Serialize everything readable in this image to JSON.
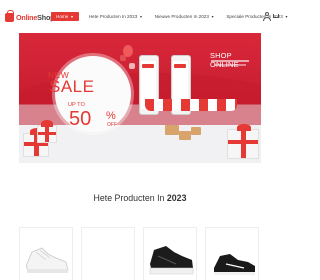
{
  "header": {
    "logo_brand": "Online",
    "logo_brand_suffix": "Shop",
    "nav": [
      {
        "label": "Home",
        "active": true
      },
      {
        "label": "Hete Producten In 2023"
      },
      {
        "label": "Nieuwe Producten In 2023"
      },
      {
        "label": "Speciale Producten In 2023"
      }
    ]
  },
  "banner": {
    "new": "NEW",
    "sale": "SALE",
    "up_to": "UP TO",
    "percent": "50",
    "percent_sign": "%",
    "off": "OFF",
    "shop_online": "SHOP ONLINE"
  },
  "section": {
    "title_prefix": "Hete Producten In",
    "title_year": "2023"
  },
  "colors": {
    "accent": "#e53935",
    "banner": "#d8283a",
    "text": "#333333"
  },
  "products": [
    {
      "name": "white-sneaker"
    },
    {
      "name": "empty"
    },
    {
      "name": "black-sneaker"
    },
    {
      "name": "black-running-shoe"
    }
  ]
}
